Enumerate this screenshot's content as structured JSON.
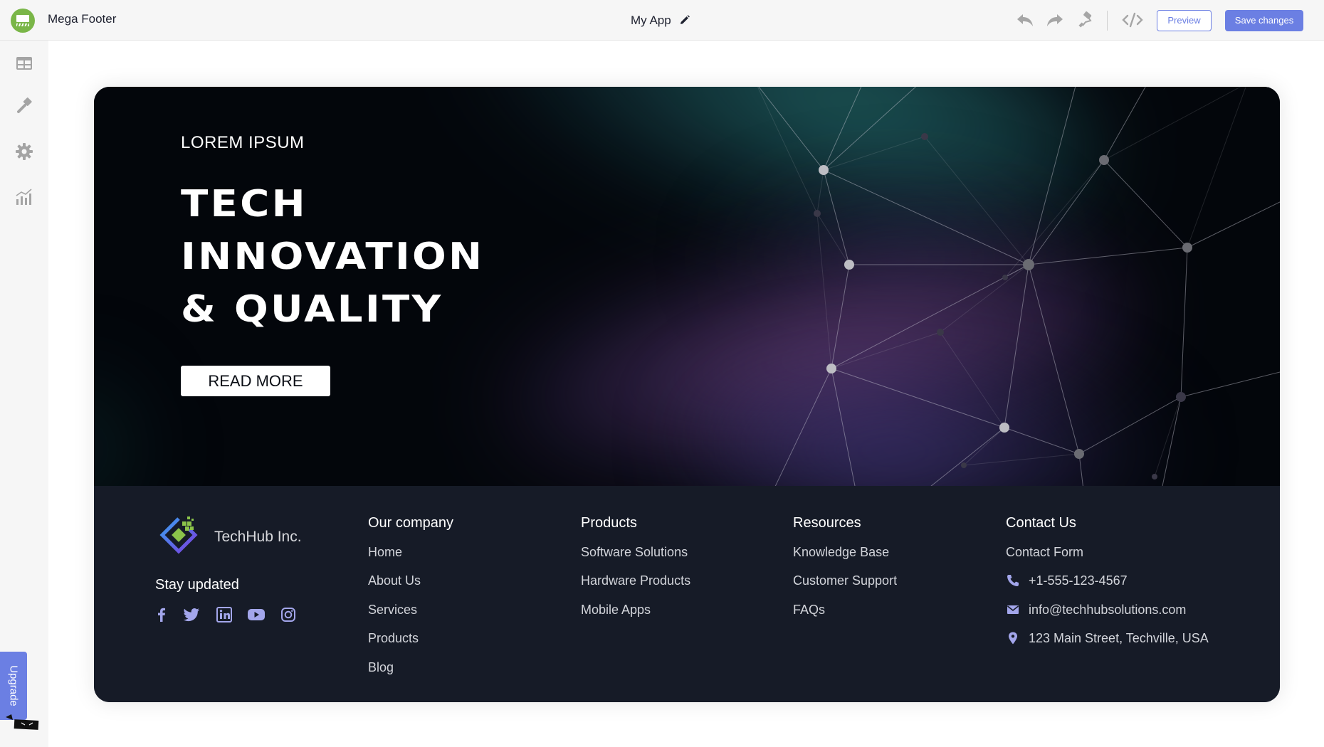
{
  "topbar": {
    "widget_name": "Mega Footer",
    "app_title": "My App",
    "preview_label": "Preview",
    "save_label": "Save changes",
    "icons": [
      "undo-icon",
      "redo-icon",
      "paint-roller-icon",
      "code-icon",
      "edit-pencil-icon"
    ]
  },
  "sidebar": {
    "items": [
      {
        "name": "layout",
        "icon": "table-layout-icon"
      },
      {
        "name": "style",
        "icon": "paintbrush-icon"
      },
      {
        "name": "settings",
        "icon": "gear-icon"
      },
      {
        "name": "analytics",
        "icon": "bar-chart-icon"
      }
    ],
    "upgrade_label": "Upgrade"
  },
  "hero": {
    "eyebrow": "LOREM IPSUM",
    "headline_lines": [
      "TECH",
      "INNOVATION",
      "& QUALITY"
    ],
    "cta_label": "READ MORE"
  },
  "footer": {
    "brand_name": "TechHub Inc.",
    "stay_updated": "Stay updated",
    "socials": [
      "facebook-icon",
      "twitter-icon",
      "linkedin-icon",
      "youtube-icon",
      "instagram-icon"
    ],
    "columns": [
      {
        "title": "Our company",
        "links": [
          "Home",
          "About Us",
          "Services",
          "Products",
          "Blog"
        ]
      },
      {
        "title": "Products",
        "links": [
          "Software Solutions",
          "Hardware Products",
          "Mobile Apps"
        ]
      },
      {
        "title": "Resources",
        "links": [
          "Knowledge Base",
          "Customer Support",
          "FAQs"
        ]
      }
    ],
    "contact": {
      "title": "Contact Us",
      "form_label": "Contact Form",
      "phone": "+1-555-123-4567",
      "email": "info@techhubsolutions.com",
      "address": "123 Main Street, Techville, USA"
    }
  },
  "colors": {
    "accent": "#6b7fe3",
    "app_logo_green": "#7ab648",
    "footer_bg": "#161b27",
    "hero_bg": "#03060b",
    "social_icon": "#a3a6eb"
  }
}
